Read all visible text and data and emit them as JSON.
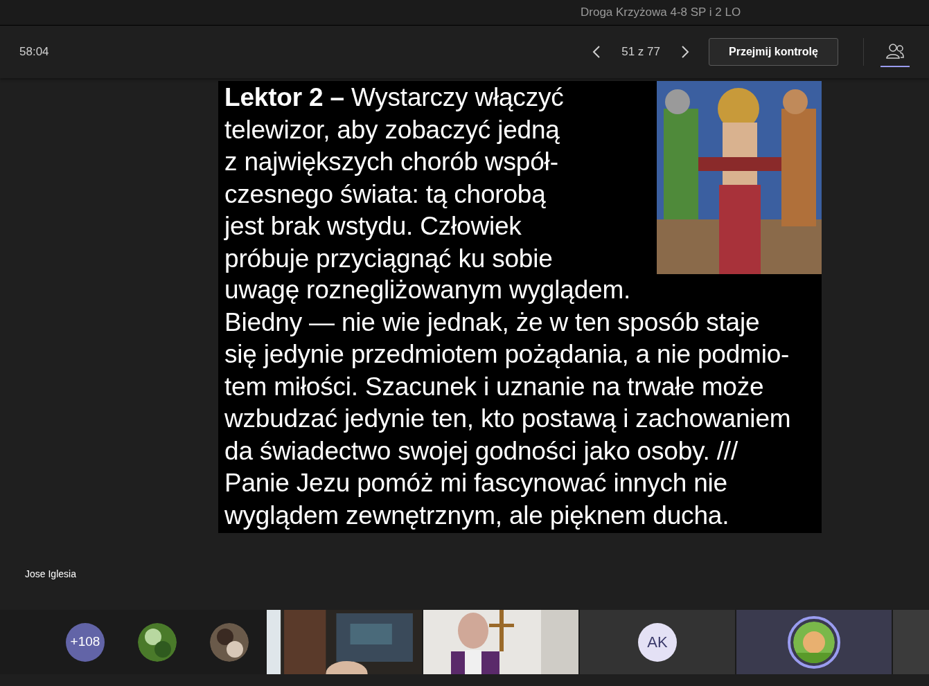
{
  "window": {
    "title": "Droga Krzyżowa 4-8 SP i 2 LO"
  },
  "toolbar": {
    "timer": "58:04",
    "slide_counter": "51 z 77",
    "take_control_button": "Przejmij kontrolę",
    "participants_button": {
      "selected": true
    }
  },
  "slide": {
    "text_beside_image": "**Lektor 2 –** Wystarczy włączyć\ntelewizor, aby zobaczyć jedną\nz największych chorób współ-\nczesnego świata: tą chorobą\njest brak wstydu. Człowiek\npróbuje przyciągnąć ku sobie",
    "text_below": "uwagę roznegliżowanym wyglądem.\nBiedny — nie wie jednak, że w ten sposób staje\nsię jedynie przedmiotem pożądania, a nie podmio-\ntem miłości. Szacunek i uznanie na trwałe może\nwzbudzać jedynie ten, kto postawą i zachowaniem\nda świadectwo swojej godności jako osoby. ///\nPanie Jezu pomóż mi fascynować innych nie\nwyglądem zewnętrznym, ale pięknem ducha."
  },
  "presenter_name": "Jose Iglesia",
  "gallery": {
    "overflow_count": "+108",
    "tiles": [
      {
        "kind": "video"
      },
      {
        "kind": "video"
      },
      {
        "kind": "initials",
        "initials": "AK",
        "speaking": false
      },
      {
        "kind": "avatar",
        "speaking": true
      },
      {
        "kind": "empty"
      }
    ]
  }
}
